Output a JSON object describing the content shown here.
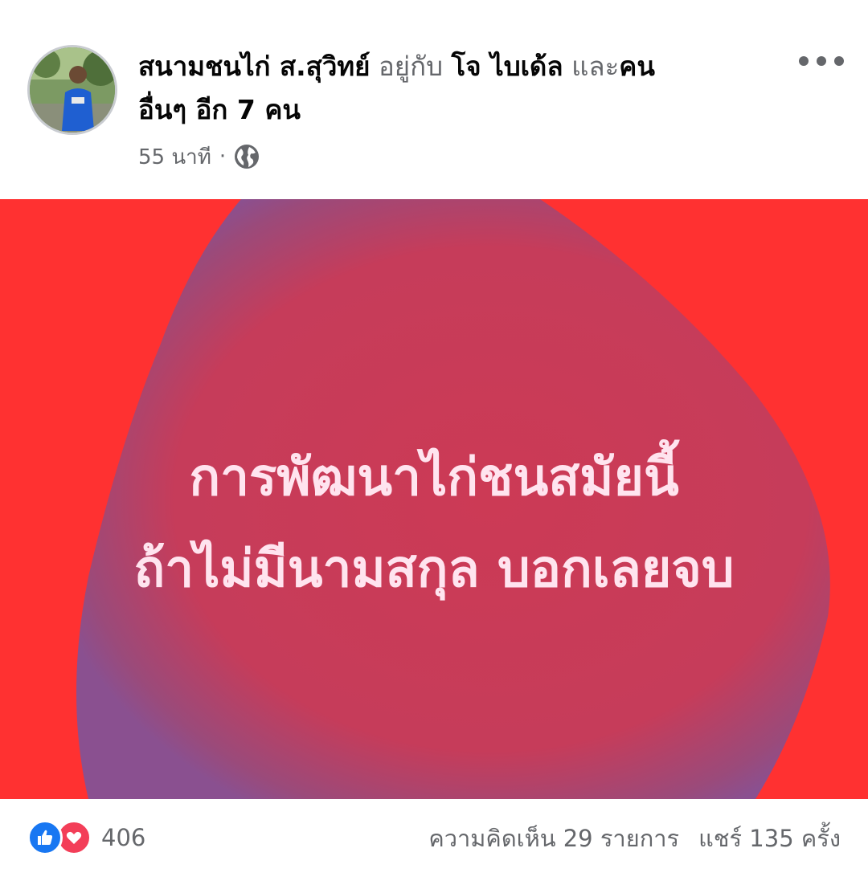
{
  "header": {
    "author": "สนามชนไก่ ส.สุวิทย์",
    "with_text": "อยู่กับ",
    "tagged_person": "โจ ไบเด้ล",
    "and_text": "และ",
    "others_line1": "คน",
    "others_line2": "อื่นๆ อีก 7 คน",
    "timestamp": "55 นาที",
    "separator": "·",
    "privacy_icon": "globe-icon",
    "menu_icon": "more-icon"
  },
  "post": {
    "line1": "การพัฒนาไก่ชนสมัยนี้",
    "line2": "ถ้าไม่มีนามสกุล บอกเลยจบ",
    "background_color": "#ff3131",
    "blob_color": "#c93a58",
    "text_color": "#ffe4ef"
  },
  "footer": {
    "reaction_icons": [
      "like-icon",
      "love-icon"
    ],
    "reaction_count": "406",
    "comments": "ความคิดเห็น 29 รายการ",
    "shares": "แชร์ 135 ครั้ง"
  }
}
